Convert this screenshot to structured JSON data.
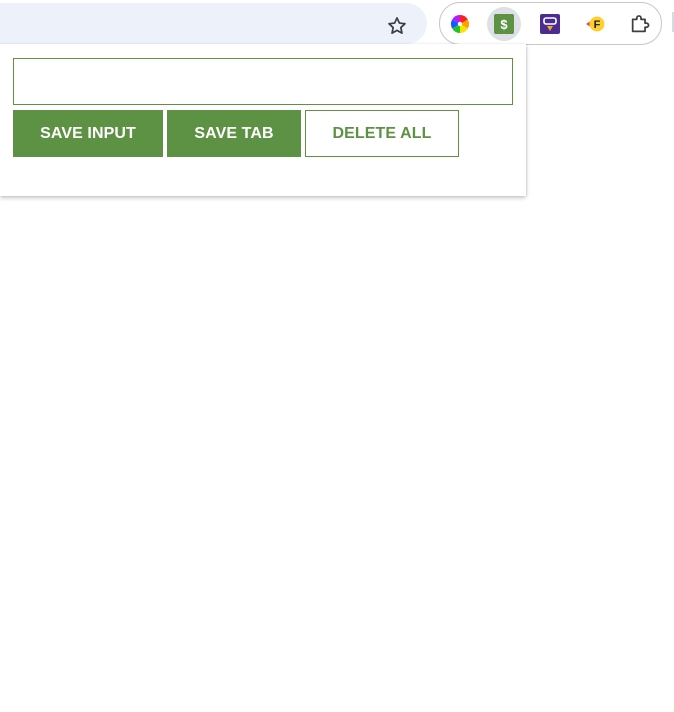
{
  "toolbar": {
    "bookmark_icon": "star-outline-icon",
    "extensions": [
      {
        "name": "color-wheel-extension",
        "icon": "color-wheel-icon"
      },
      {
        "name": "dollar-extension",
        "icon": "dollar-icon",
        "active": true,
        "glyph": "$"
      },
      {
        "name": "purple-extension",
        "icon": "purple-badge-icon"
      },
      {
        "name": "f-extension",
        "icon": "f-badge-icon",
        "glyph": "F"
      },
      {
        "name": "extensions-menu",
        "icon": "puzzle-piece-icon"
      }
    ]
  },
  "popup": {
    "input": {
      "value": "",
      "placeholder": ""
    },
    "buttons": {
      "save_input": "SAVE INPUT",
      "save_tab": "SAVE TAB",
      "delete_all": "DELETE ALL"
    }
  },
  "colors": {
    "accent": "#5d9144",
    "omnibox": "#edf2fa"
  }
}
